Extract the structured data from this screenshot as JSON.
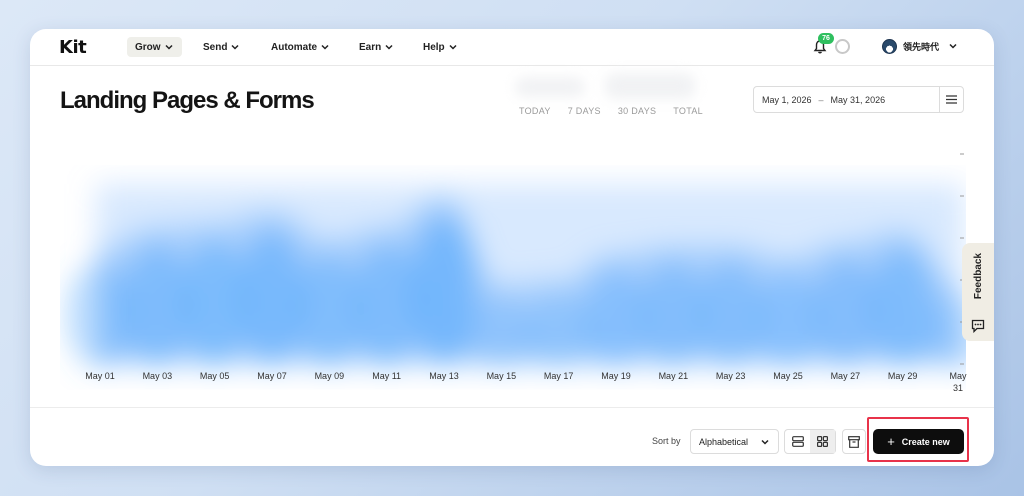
{
  "app": {
    "logo": "Kit"
  },
  "nav": {
    "items": [
      {
        "label": "Grow",
        "active": true
      },
      {
        "label": "Send",
        "active": false
      },
      {
        "label": "Automate",
        "active": false
      },
      {
        "label": "Earn",
        "active": false
      },
      {
        "label": "Help",
        "active": false
      }
    ],
    "notifications": {
      "count": "76",
      "icon": "bell-icon"
    },
    "user": {
      "name": "領先時代",
      "icon": "avatar"
    }
  },
  "header": {
    "title": "Landing Pages & Forms",
    "range_tabs": [
      "TODAY",
      "7 DAYS",
      "30 DAYS",
      "TOTAL"
    ],
    "date_range": {
      "start": "May 1, 2026",
      "separator": "–",
      "end": "May 31, 2026"
    }
  },
  "chart_data": {
    "type": "area",
    "x": [
      "May 01",
      "May 03",
      "May 05",
      "May 07",
      "May 09",
      "May 11",
      "May 13",
      "May 15",
      "May 17",
      "May 19",
      "May 21",
      "May 23",
      "May 25",
      "May 27",
      "May 29",
      "May 31"
    ],
    "series": [
      {
        "values": [
          0.62,
          0.72,
          0.74,
          0.8,
          0.66,
          0.72,
          0.88,
          0.42,
          0.44,
          0.58,
          0.62,
          0.62,
          0.56,
          0.64,
          0.7,
          0.42
        ],
        "color": "#4aa3fb"
      }
    ],
    "grid": false,
    "blurred": true,
    "fill_color": "#a8cffd"
  },
  "feedback": {
    "label": "Feedback"
  },
  "toolbar": {
    "sort_label": "Sort by",
    "sort_value": "Alphabetical",
    "create_label": "Create new",
    "accent": "#e8334a"
  }
}
